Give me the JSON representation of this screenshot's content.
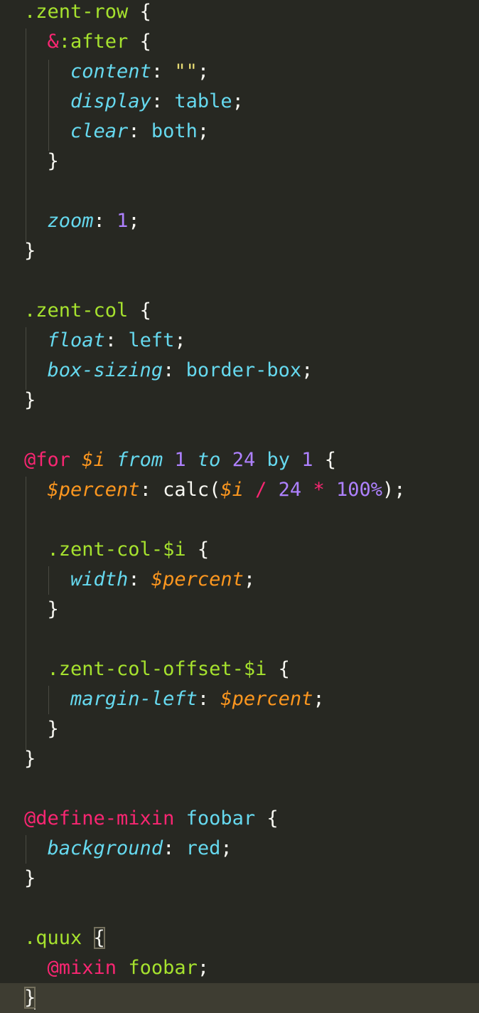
{
  "editor": {
    "theme": {
      "background": "#272822",
      "current_line": "#3E3D32",
      "selector": "#A6E22E",
      "property": "#66D9EF",
      "number": "#AE81FF",
      "string": "#E6DB74",
      "keyword": "#F92672",
      "variable": "#FD971F"
    },
    "lines": {
      "l1": {
        "sel": ".zent-row",
        "brace": " {"
      },
      "l2": {
        "amp": "&",
        "sel": ":after",
        "brace": " {"
      },
      "l3": {
        "prop": "content",
        "colon": ": ",
        "str": "\"\"",
        "semi": ";"
      },
      "l4": {
        "prop": "display",
        "colon": ": ",
        "val": "table",
        "semi": ";"
      },
      "l5": {
        "prop": "clear",
        "colon": ": ",
        "val": "both",
        "semi": ";"
      },
      "l6": {
        "brace": "}"
      },
      "l8": {
        "prop": "zoom",
        "colon": ": ",
        "num": "1",
        "semi": ";"
      },
      "l9": {
        "brace": "}"
      },
      "l11": {
        "sel": ".zent-col",
        "brace": " {"
      },
      "l12": {
        "prop": "float",
        "colon": ": ",
        "val": "left",
        "semi": ";"
      },
      "l13": {
        "prop": "box-sizing",
        "colon": ": ",
        "val": "border-box",
        "semi": ";"
      },
      "l14": {
        "brace": "}"
      },
      "l16": {
        "kw": "@for",
        "var": "$i",
        "from": "from",
        "n1": "1",
        "to": "to",
        "n2": "24",
        "by": "by",
        "n3": "1",
        "brace": "{"
      },
      "l17": {
        "var": "$percent",
        "colon": ": ",
        "fn": "calc(",
        "var2": "$i",
        "op1": "/",
        "n1": "24",
        "op2": "*",
        "n2": "100%",
        "close": ");"
      },
      "l19": {
        "sel": ".zent-col-$i",
        "brace": " {"
      },
      "l20": {
        "prop": "width",
        "colon": ": ",
        "var": "$percent",
        "semi": ";"
      },
      "l21": {
        "brace": "}"
      },
      "l23": {
        "sel": ".zent-col-offset-$i",
        "brace": " {"
      },
      "l24": {
        "prop": "margin-left",
        "colon": ": ",
        "var": "$percent",
        "semi": ";"
      },
      "l25": {
        "brace": "}"
      },
      "l26": {
        "brace": "}"
      },
      "l28": {
        "kw": "@define-mixin",
        "name": "foobar",
        "brace": " {"
      },
      "l29": {
        "prop": "background",
        "colon": ": ",
        "val": "red",
        "semi": ";"
      },
      "l30": {
        "brace": "}"
      },
      "l32": {
        "sel": ".quux",
        "brace": "{"
      },
      "l33": {
        "kw": "@mixin",
        "name": "foobar",
        "semi": ";"
      },
      "l34": {
        "brace": "}"
      }
    }
  }
}
